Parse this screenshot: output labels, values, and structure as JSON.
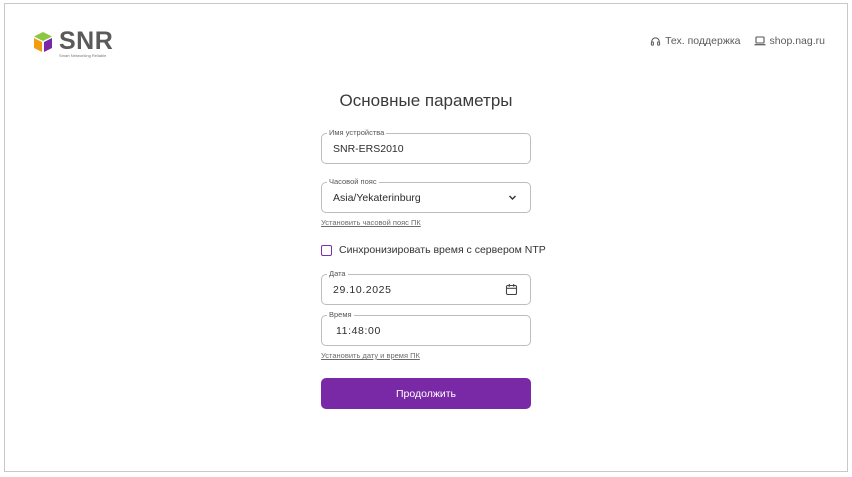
{
  "header": {
    "logo_text": "SNR",
    "logo_tagline": "Smart Networking Reliable",
    "support_label": "Тех. поддержка",
    "shop_label": "shop.nag.ru"
  },
  "page": {
    "title": "Основные параметры"
  },
  "form": {
    "device_name": {
      "label": "Имя устройства",
      "value": "SNR-ERS2010"
    },
    "timezone": {
      "label": "Часовой пояс",
      "value": "Asia/Yekaterinburg"
    },
    "set_pc_timezone_link": "Установить часовой пояс ПК",
    "ntp_sync_label": "Синхронизировать время с сервером NTP",
    "date": {
      "label": "Дата",
      "value": "29.10.2025"
    },
    "time": {
      "label": "Время",
      "value": "11:48:00"
    },
    "set_pc_datetime_link": "Установить дату и время ПК",
    "submit_label": "Продолжить"
  },
  "colors": {
    "accent": "#7a29a6",
    "logo_green": "#8dc63f",
    "logo_orange": "#f39c12",
    "logo_purple": "#7a29a6"
  },
  "icons": [
    "headset-icon",
    "laptop-icon",
    "chevron-down-icon",
    "calendar-icon"
  ]
}
